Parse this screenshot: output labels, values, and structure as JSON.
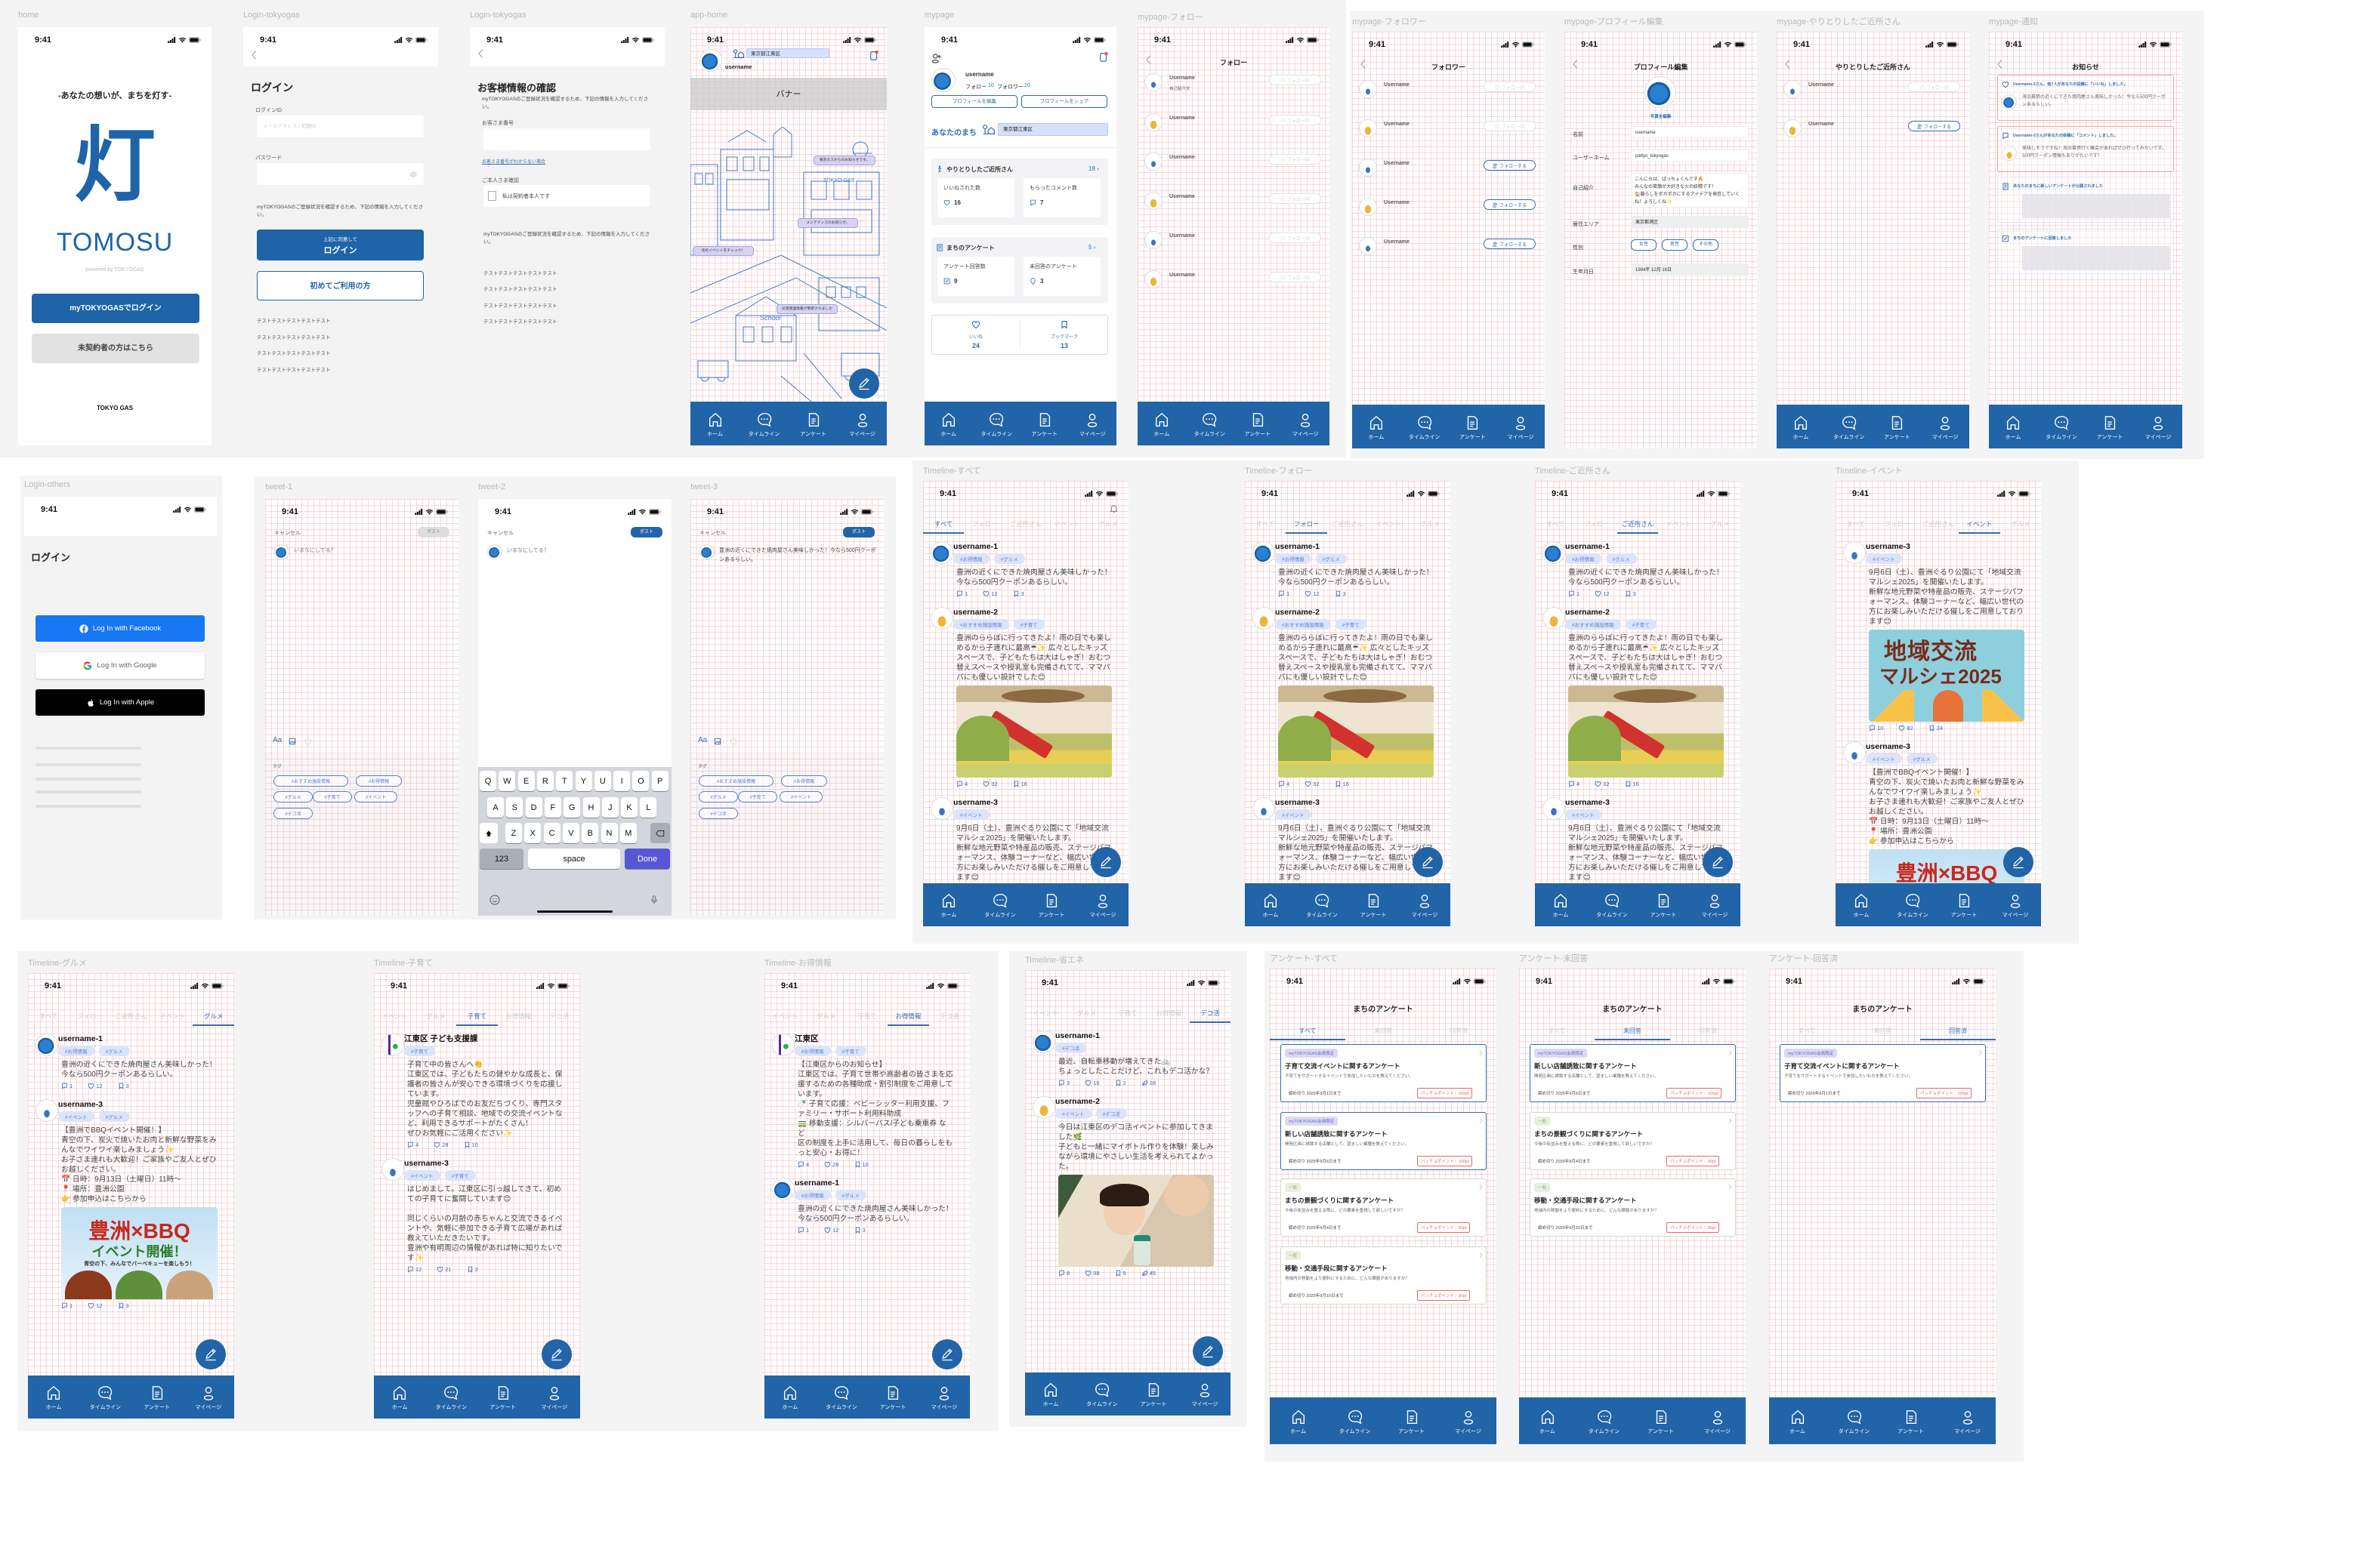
{
  "status_time": "9:41",
  "colors": {
    "brand": "#2164a8",
    "accent": "#2f6db5",
    "tag_bg": "#dce4fb",
    "canvas": "#f4f4f4",
    "point_red": "#e86a6a"
  },
  "nav": [
    {
      "label": "ホーム",
      "icon": "home-icon"
    },
    {
      "label": "タイムライン",
      "icon": "chat-bubble-icon"
    },
    {
      "label": "アンケート",
      "icon": "survey-document-icon"
    },
    {
      "label": "マイページ",
      "icon": "person-icon"
    }
  ],
  "home": {
    "label": "home",
    "tagline": "-あなたの想いが、まちを灯す-",
    "logo_mark": "灯",
    "logo_text": "TOMOSU",
    "powered": "powered by TOKYOGAS",
    "primary_button": "myTOKYOGASでログイン",
    "secondary_button": "未契約者の方はこちら",
    "footer_logo": "TOKYO GAS"
  },
  "login_tokyogas": {
    "label": "Login-tokyogas",
    "title": "ログイン",
    "id_label": "ログインID",
    "id_placeholder": "メールアドレス / 初期ID",
    "password_label": "パスワード",
    "note": "myTOKYOGASのご登録状況を確認するため、下記の情報を入力してください。",
    "login_button_sub": "上記に同意して",
    "login_button": "ログイン",
    "first_time_button": "初めてご利用の方",
    "test_lines": [
      "テストテストテストテストテスト",
      "テストテストテストテストテスト",
      "テストテストテストテストテスト",
      "テストテストテストテストテスト"
    ]
  },
  "customer_confirm": {
    "label": "Login-tokyogas",
    "title": "お客様情報の確認",
    "note": "myTOKYOGASのご登録状況を確認するため、下記の情報を入力してください。",
    "number_label": "お客さま番号",
    "number_help_link": "お客さま番号がわからない場合",
    "identity_label": "ご本人さま確認",
    "identity_checkbox": "私は契約者本人です",
    "note2": "myTOKYOGASのご登録状況を確認するため、下記の情報を入力してください。",
    "test_lines": [
      "テストテストテストテストテスト",
      "テストテストテストテストテスト",
      "テストテストテストテストテスト",
      "テストテストテストテストテスト"
    ]
  },
  "app_home": {
    "label": "app-home",
    "area": "東京都江東区",
    "username": "username",
    "banner": "バナー",
    "bubbles": [
      "東京ガスからのお知らせです。",
      "メンテナンスのお知らせ。",
      "旬のイベントをチェック！",
      "災害関連情報が更新されました"
    ],
    "signs": [
      "TOKYO GAS",
      "School"
    ]
  },
  "mypage": {
    "label": "mypage",
    "username": "username",
    "follow_label": "フォロー",
    "follow_count": "10",
    "follower_label": "フォロワー",
    "follower_count": "20",
    "edit_button": "プロフィールを編集",
    "share_button": "プロフィールをシェア",
    "town_label": "あなたのまち",
    "town_value": "東京都江東区",
    "neighbors_title": "やりとりしたご近所さん",
    "neighbors_count": "18 ›",
    "likes_received_label": "いいねされた数",
    "likes_received": "16",
    "comments_received_label": "もらったコメント数",
    "comments_received": "7",
    "survey_title": "まちのアンケート",
    "survey_count": "5 ›",
    "answered_label": "アンケート回答数",
    "answered": "9",
    "unanswered_label": "未回答のアンケート",
    "unanswered": "3",
    "likes_label": "いいね",
    "likes": "24",
    "bookmarks_label": "ブックマーク",
    "bookmarks": "13"
  },
  "follow_list": {
    "label": "mypage-フォロー",
    "title": "フォロー",
    "bio": "自己紹介文",
    "users": [
      {
        "name": "Username",
        "button": "フォロー中",
        "state": "following"
      },
      {
        "name": "Username",
        "button": "フォロー中",
        "state": "following"
      },
      {
        "name": "Username",
        "button": "フォロー中",
        "state": "following"
      },
      {
        "name": "Username",
        "button": "フォロー中",
        "state": "following"
      },
      {
        "name": "Username",
        "button": "フォロー中",
        "state": "following"
      },
      {
        "name": "Username",
        "button": "フォロー中",
        "state": "following"
      }
    ]
  },
  "follower_list": {
    "label": "mypage-フォロワー",
    "title": "フォロワー",
    "users": [
      {
        "name": "Username",
        "button": "フォロー中",
        "state": "following"
      },
      {
        "name": "Username",
        "button": "フォロー中",
        "state": "following"
      },
      {
        "name": "Username",
        "button": "フォローする",
        "state": "follow"
      },
      {
        "name": "Username",
        "button": "フォローする",
        "state": "follow"
      },
      {
        "name": "Username",
        "button": "フォローする",
        "state": "follow"
      }
    ]
  },
  "profile_edit": {
    "label": "mypage-プロフィール編集",
    "title": "プロフィール編集",
    "photo_edit": "写真を編集",
    "fields": [
      {
        "label": "名前",
        "value": "username"
      },
      {
        "label": "ユーザーネーム",
        "value": "pattyo_tokyogas"
      },
      {
        "label": "自己紹介",
        "value": "こんにちは、ぱっちょくんです🔥\nみんなの笑顔が大好きな火の妖精です！\n🏠暮らしをポカポカにするアイデアを発信していくね！よろしくね✨"
      },
      {
        "label": "居住エリア",
        "value": "東京都港区"
      },
      {
        "label": "性別",
        "options": [
          "女性",
          "男性",
          "その他"
        ]
      },
      {
        "label": "生年月日",
        "value": "1994年 12月 16日"
      }
    ]
  },
  "neighbors_list": {
    "label": "mypage-やりとりしたご近所さん",
    "title": "やりとりしたご近所さん",
    "users": [
      {
        "name": "Username",
        "button": "フォロー中",
        "state": "following"
      },
      {
        "name": "Username",
        "button": "フォローする",
        "state": "follow"
      }
    ]
  },
  "notices": {
    "label": "mypage-通知",
    "title": "お知らせ",
    "items": [
      {
        "icon": "heart-icon",
        "title": "Username-2さん、他7人があなたの投稿に「いいね」しました。",
        "body": "海浜幕張の近くにできた焼肉屋さん美味しかった！今なら500円クーポンあるらしい。"
      },
      {
        "icon": "comment-icon",
        "title": "Username-2さんがあなたの投稿に「コメント」しました。",
        "body": "美味しそうですね！海浜幕張行く機会があればぜひ行ってみたいです。500円クーポン情報もありがたいです！"
      },
      {
        "icon": "survey-icon",
        "title": "あなたのまちに新しいアンケートが公開されました"
      },
      {
        "icon": "checkbox-icon",
        "title": "まちのアンケートに回答しました"
      }
    ]
  },
  "login_others": {
    "label": "Login-others",
    "title": "ログイン",
    "facebook": "Log In with Facebook",
    "google": "Log In with Google",
    "apple": "Log In with Apple"
  },
  "tweet": {
    "labels": [
      "tweet-1",
      "tweet-2",
      "tweet-3"
    ],
    "cancel": "キャンセル",
    "post": "ポスト",
    "placeholder": "いまなにしてる？",
    "draft_text": "豊洲の近くにできた焼肉屋さん美味しかった！今なら500円クーポンあるらしい。",
    "text_tool": "Aa",
    "tag_label": "タグ",
    "tags": [
      "#おすすめ施設情報",
      "#お得情報",
      "#グルメ",
      "#子育て",
      "#イベント",
      "#デコ活"
    ],
    "keyboard": {
      "rows": [
        [
          "Q",
          "W",
          "E",
          "R",
          "T",
          "Y",
          "U",
          "I",
          "O",
          "P"
        ],
        [
          "A",
          "S",
          "D",
          "F",
          "G",
          "H",
          "J",
          "K",
          "L"
        ],
        [
          "Z",
          "X",
          "C",
          "V",
          "B",
          "N",
          "M"
        ]
      ],
      "numbers": "123",
      "space": "space",
      "done": "Done"
    }
  },
  "timeline_tabs": [
    [
      "すべて",
      "フォロー",
      "ご近所さん",
      "イベント",
      "グルメ"
    ],
    [
      "イベント",
      "グルメ",
      "子育て",
      "お得情報",
      "デコ活"
    ]
  ],
  "posts": [
    {
      "user": "username-1",
      "avatar": "mascot-blue-avatar",
      "tags": [
        "#お得情報",
        "#グルメ"
      ],
      "text": "豊洲の近くにできた焼肉屋さん美味しかった！\n今なら500円クーポンあるらしい。",
      "comments": "1",
      "likes": "12",
      "bookmarks": "3"
    },
    {
      "user": "username-2",
      "avatar": "mascot-yellow-avatar",
      "tags": [
        "#おすすめ施設情報",
        "#子育て"
      ],
      "text": "豊洲のららぽに行ってきたよ！雨の日でも楽しめるから子連れに最高☔✨ 広々としたキッズスペースで、子どもたちは大はしゃぎ！おむつ替えスペースや授乳室も完備されてて、ママパパにも優しい設計でした😊",
      "image": "playground-photo",
      "comments": "4",
      "likes": "32",
      "bookmarks": "16"
    },
    {
      "user": "username-3",
      "avatar": "mascot-white-avatar",
      "tags": [
        "#イベント"
      ],
      "text": "9月6日（土）、豊洲ぐるり公園にて「地域交流マルシェ2025」を開催いたします。\n新鮮な地元野菜や特産品の販売、ステージパフォーマンス、体験コーナーなど、幅広い世代の方にお楽しみいただける催しをご用意しております😊",
      "image": "marche-poster",
      "image_text": [
        "地域交流",
        "マルシェ2025"
      ],
      "comments": "10",
      "likes": "82",
      "bookmarks": "24"
    },
    {
      "user": "username-3",
      "avatar": "mascot-white-avatar",
      "tags": [
        "#イベント",
        "#グルメ"
      ],
      "text": "【豊洲でBBQイベント開催！】\n青空の下、炭火で焼いたお肉と新鮮な野菜をみんなでワイワイ楽しみましょう✨\nお子さま連れも大歓迎！ご家族やご友人とぜひお越しください。\n📅 日時：9月13日（土曜日）11時〜\n📍 場所：豊洲公園\n👉 参加申込はこちらから",
      "image": "bbq-poster",
      "image_text": [
        "豊洲×BBQ",
        "イベント開催！",
        "青空の下、みんなでバーベキューを楽しもう！"
      ],
      "comments": "1",
      "likes": "12",
      "bookmarks": "3"
    },
    {
      "user": "江東区 子ども支援課",
      "avatar": "koto-ward-logo",
      "tags": [
        "#子育て"
      ],
      "text": "子育て中の皆さんへ👏\n江東区では、子どもたちの健やかな成長と、保護者の皆さんが安心できる環境づくりを応援しています。\n児童館やひろばでのお友だちづくり、専門スタッフへの子育て相談、地域での交流イベントなど、利用できるサポートがたくさん！\nぜひお気軽にご活用ください✨",
      "comments": "4",
      "likes": "28",
      "bookmarks": "10"
    },
    {
      "user": "username-3",
      "avatar": "mascot-white-avatar",
      "tags": [
        "#イベント",
        "#子育て"
      ],
      "text": "はじめまして。江東区に引っ越してきて、初めての子育てに奮闘しています😊\n\n同じくらいの月齢の赤ちゃんと交流できるイベントや、気軽に参加できる子育て広場があれば教えていただきたいです。\n豊洲や有明周辺の情報があれば特に知りたいです✨",
      "comments": "12",
      "likes": "21",
      "bookmarks": "2"
    },
    {
      "user": "江東区",
      "avatar": "koto-ward-logo",
      "tags": [
        "#お得情報",
        "#子育て"
      ],
      "text": "【江東区からのお知らせ】\n江東区では、子育て世帯や高齢者の皆さまを応援するための各種助成・割引制度をご用意しています。\n🍼 子育て応援：ベビーシッター利用支援、ファミリー・サポート利用料助成\n🚃 移動支援：シルバーパス/子ども乗車券 など\n区の制度を上手に活用して、毎日の暮らしをもっと安心・お得に！",
      "comments": "4",
      "likes": "28",
      "bookmarks": "10"
    },
    {
      "user": "username-1",
      "avatar": "mascot-blue-avatar",
      "tags": [
        "#デコ活"
      ],
      "text": "最近、自転車移動が増えてきた🚲\nちょっとしたことだけど、これもデコ活かな？",
      "comments": "3",
      "likes": "16",
      "bookmarks": "2",
      "deco": "18"
    },
    {
      "user": "username-2",
      "avatar": "mascot-yellow-avatar",
      "tags": [
        "#イベント",
        "#デコ活"
      ],
      "text": "今日は江東区のデコ活イベントに参加してきました🌿\n子どもと一緒にマイボトル作りを体験！楽しみながら環境にやさしい生活を考えられてよかった。",
      "image": "family-photo",
      "comments": "8",
      "likes": "38",
      "bookmarks": "9",
      "deco": "45"
    }
  ],
  "timelines": [
    {
      "label": "Timeline-すべて",
      "tabset": 0,
      "active": 0,
      "posts": [
        0,
        1,
        2
      ],
      "bell": true
    },
    {
      "label": "Timeline-フォロー",
      "tabset": 0,
      "active": 1,
      "posts": [
        0,
        1,
        2
      ]
    },
    {
      "label": "Timeline-ご近所さん",
      "tabset": 0,
      "active": 2,
      "posts": [
        0,
        1,
        2
      ]
    },
    {
      "label": "Timeline-イベント",
      "tabset": 0,
      "active": 3,
      "posts": [
        2,
        3
      ]
    },
    {
      "label": "Timeline-グルメ",
      "tabset": 0,
      "active": 4,
      "posts": [
        0,
        3
      ]
    },
    {
      "label": "Timeline-子育て",
      "tabset": 1,
      "active": 2,
      "posts": [
        4,
        5
      ]
    },
    {
      "label": "Timeline-お得情報",
      "tabset": 1,
      "active": 3,
      "posts": [
        6,
        0
      ]
    },
    {
      "label": "Timeline-省エネ",
      "tabset": 1,
      "active": 4,
      "posts": [
        7,
        8
      ]
    }
  ],
  "surveys": {
    "title": "まちのアンケート",
    "tabs": [
      "すべて",
      "未回答",
      "回答済"
    ],
    "items": [
      {
        "badge": "myTOKYOGAS会員限定",
        "member": true,
        "title": "子育て交流イベントに関するアンケート",
        "desc": "子育てをサポートするイベントで参加したいものを教えてください。",
        "deadline": "締め切り 2025年9月1日まで",
        "points": "パッチョポイント：100pt"
      },
      {
        "badge": "myTOKYOGAS会員限定",
        "member": true,
        "title": "新しい店舗誘致に関するアンケート",
        "desc": "開発区画に誘致する店舗として、望ましい業種を教えてください。",
        "deadline": "締め切り 2025年9月6日まで",
        "points": "パッチョポイント：100pt"
      },
      {
        "badge": "一般",
        "member": false,
        "title": "まちの景観づくりに関するアンケート",
        "desc": "今後の街並みを整える際に、どの要素を重視して欲しいですか？",
        "deadline": "締め切り 2025年9月4日まで",
        "points": "パッチョポイント：30pt"
      },
      {
        "badge": "一般",
        "member": false,
        "title": "移動・交通手段に関するアンケート",
        "desc": "地域内の移動をより便利にするために、どんな課題がありますか？",
        "deadline": "締め切り 2025年9月10日まで",
        "points": "パッチョポイント：30pt"
      }
    ],
    "screens": [
      {
        "label": "アンケート-すべて",
        "active": 0,
        "items": [
          0,
          1,
          2,
          3
        ]
      },
      {
        "label": "アンケート-未回答",
        "active": 1,
        "items": [
          1,
          2,
          3
        ]
      },
      {
        "label": "アンケート-回答済",
        "active": 2,
        "items": [
          0
        ]
      }
    ]
  }
}
